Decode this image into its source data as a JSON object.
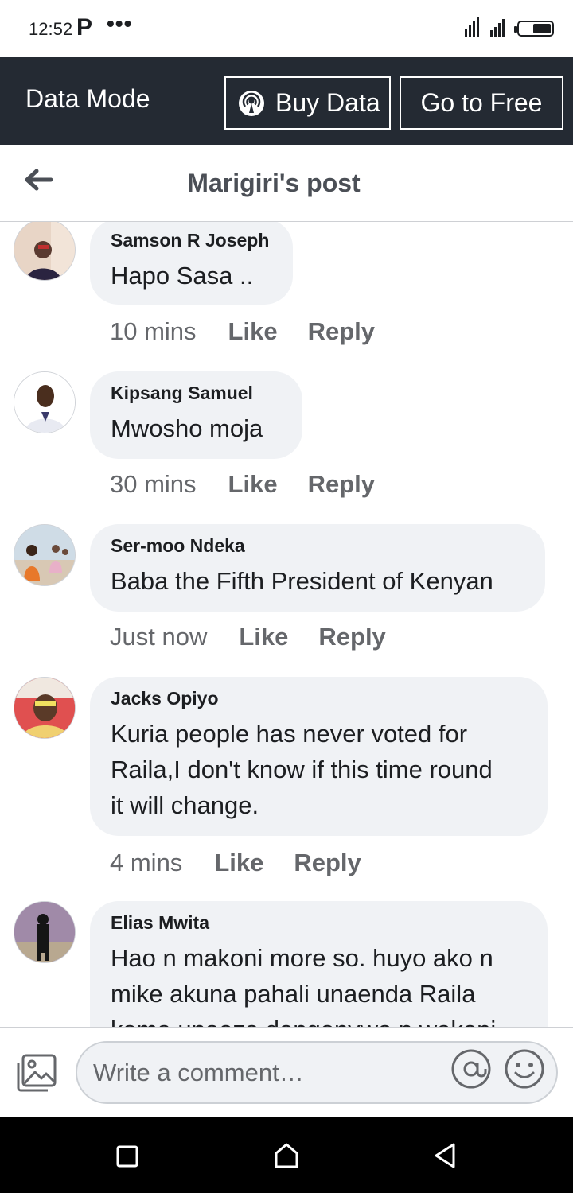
{
  "status_bar": {
    "time": "12:52",
    "app_letter": "P",
    "more": "•••"
  },
  "data_mode": {
    "label": "Data Mode",
    "buy_data": "Buy Data",
    "go_free": "Go to Free"
  },
  "header": {
    "title": "Marigiri's post"
  },
  "comments": [
    {
      "author": "Samson R Joseph",
      "lines": [
        "Hapo Sasa .."
      ],
      "time": "10 mins",
      "like": "Like",
      "reply": "Reply",
      "avatar_colors": [
        "#e0c2b0",
        "#3a2a4a"
      ]
    },
    {
      "author": "Kipsang Samuel",
      "lines": [
        "Mwosho moja"
      ],
      "time": "30 mins",
      "like": "Like",
      "reply": "Reply",
      "avatar_colors": [
        "#ffffff",
        "#4a3020"
      ]
    },
    {
      "author": "Ser-moo Ndeka",
      "lines": [
        "Baba the Fifth President of Kenyan"
      ],
      "time": "Just now",
      "like": "Like",
      "reply": "Reply",
      "avatar_colors": [
        "#c9d8e6",
        "#e07a2a"
      ]
    },
    {
      "author": "Jacks Opiyo",
      "lines": [
        "Kuria people has never voted for",
        "Raila,I don't know if this time round",
        "it will change."
      ],
      "time": "4 mins",
      "like": "Like",
      "reply": "Reply",
      "avatar_colors": [
        "#d84040",
        "#f0d080"
      ]
    },
    {
      "author": "Elias Mwita",
      "lines": [
        "Hao n makoni more so. huyo ako n",
        "mike akuna pahali unaenda Raila",
        "kama unaeza dongonywa n wakoni"
      ],
      "time": "",
      "like": "",
      "reply": "",
      "avatar_colors": [
        "#9a7aa8",
        "#1a1a1a"
      ]
    }
  ],
  "composer": {
    "placeholder": "Write a comment…"
  },
  "icons": {
    "back": "arrow-left-icon",
    "buy": "broadcast-icon",
    "photo": "photo-icon",
    "at": "at-icon",
    "emoji": "emoji-icon"
  }
}
